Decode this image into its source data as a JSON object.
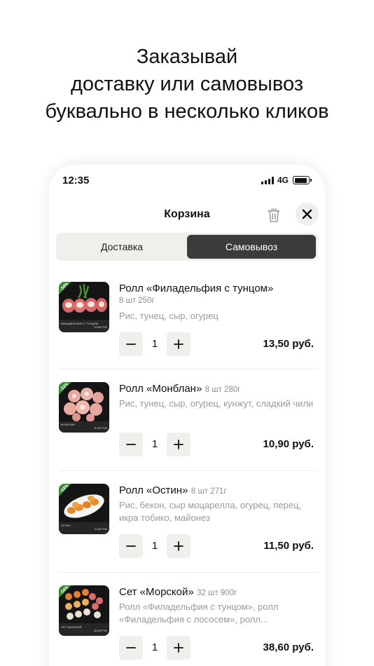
{
  "headline": {
    "line1": "Заказывай",
    "line2": "доставку или самовывоз",
    "line3": "буквально в несколько кликов"
  },
  "status": {
    "time": "12:35",
    "network": "4G"
  },
  "header": {
    "title": "Корзина",
    "trash_icon": "trash-icon",
    "close_icon": "close-icon"
  },
  "tabs": [
    {
      "label": "Доставка",
      "active": false
    },
    {
      "label": "Самовывоз",
      "active": true
    }
  ],
  "cart": [
    {
      "name": "Ролл «Филадельфия с тунцом»",
      "meta": "8 шт 250г",
      "description": "Рис, тунец, сыр, огурец",
      "quantity": "1",
      "price": "13,50 руб.",
      "badge": "-34%",
      "thumb_caption": "ФИЛАДЕЛЬФИЯ С ТУНЦОМ",
      "thumb_price": "13,50 РУБ"
    },
    {
      "name": "Ролл «Монблан»",
      "meta": "8 шт 280г",
      "description": "Рис, тунец, сыр, огурец, кунжут, сладкий чили",
      "quantity": "1",
      "price": "10,90 руб.",
      "badge": "-33%",
      "thumb_caption": "МОНБЛАН",
      "thumb_price": "10,90 РУБ"
    },
    {
      "name": "Ролл «Остин»",
      "meta": "8 шт 271г",
      "description": "Рис, бекон, сыр моцарелла, огурец, перец, икра тобико, майонез",
      "quantity": "1",
      "price": "11,50 руб.",
      "badge": "-43%",
      "thumb_caption": "ОСТИН",
      "thumb_price": "11,50 РУБ"
    },
    {
      "name": "Сет «Морской»",
      "meta": "32 шт 900г",
      "description": "Ролл «Филадельфия с тунцом», ролл «Филадельфия с лососем», ролл...",
      "quantity": "1",
      "price": "38,60 руб.",
      "badge": "-34%",
      "thumb_caption": "СЕТ МОРСКОЙ",
      "thumb_price": "38,60 РУБ"
    }
  ],
  "colors": {
    "accent_dark": "#3b3b3b",
    "chip_bg": "#f1efeb",
    "badge_green": "#3f8a3a",
    "muted_text": "#9a9a9a"
  }
}
